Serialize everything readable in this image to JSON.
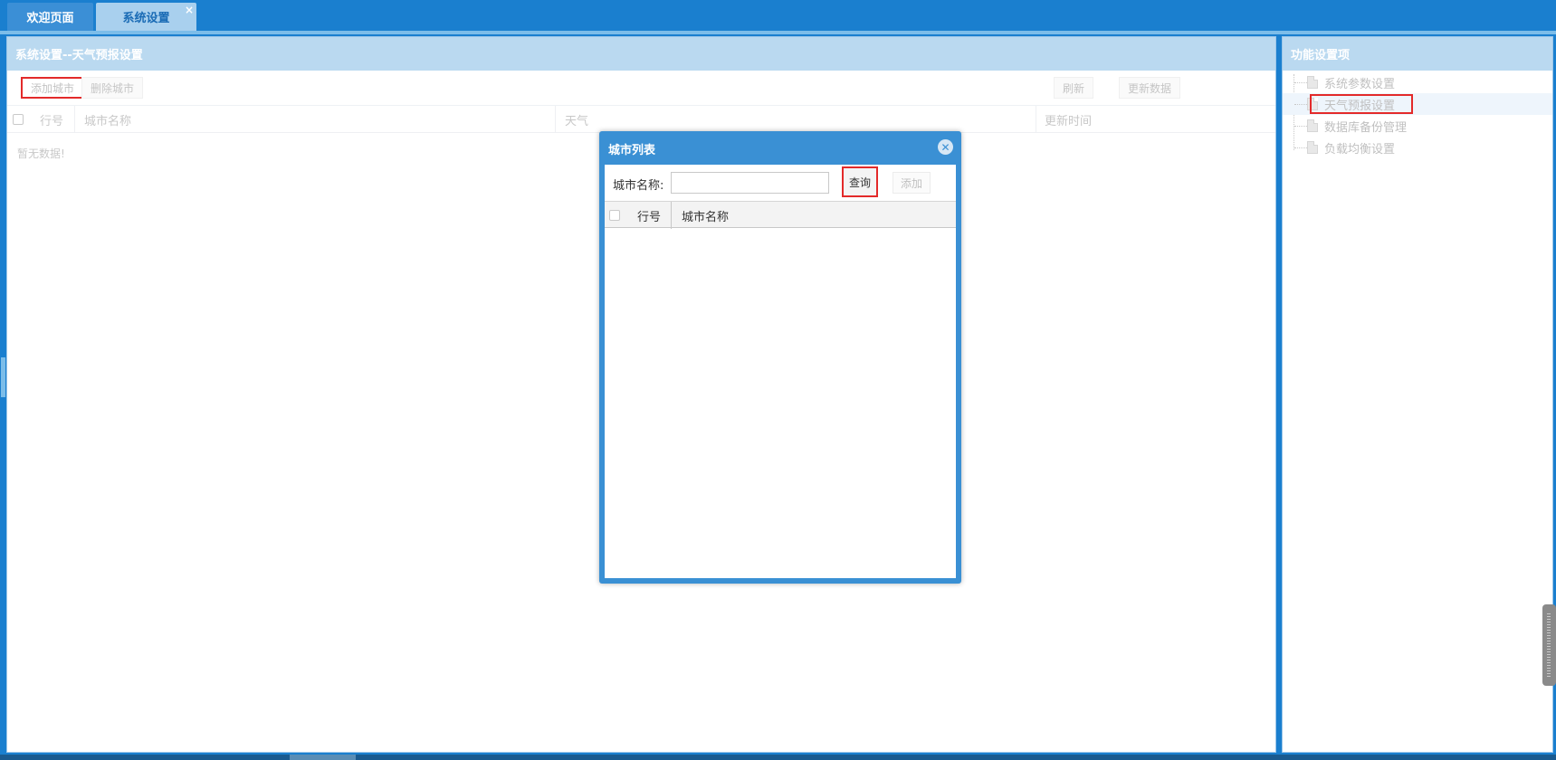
{
  "tabs": {
    "welcome": "欢迎页面",
    "settings": "系统设置",
    "close_glyph": "×"
  },
  "main_panel": {
    "title": "系统设置--天气预报设置",
    "toolbar": {
      "add_city": "添加城市",
      "delete_city": "删除城市",
      "refresh": "刷新",
      "update_data": "更新数据"
    },
    "grid": {
      "columns": [
        "行号",
        "城市名称",
        "天气",
        "更新时间"
      ],
      "rows": [],
      "empty_text": "暂无数据!"
    }
  },
  "side_panel": {
    "title": "功能设置项",
    "items": [
      {
        "label": "系统参数设置",
        "selected": false
      },
      {
        "label": "天气预报设置",
        "selected": true
      },
      {
        "label": "数据库备份管理",
        "selected": false
      },
      {
        "label": "负载均衡设置",
        "selected": false
      }
    ],
    "icon": "document-icon"
  },
  "dialog": {
    "title": "城市列表",
    "close_icon": "close-circle-icon",
    "search_label": "城市名称:",
    "search_value": "",
    "query_button": "查询",
    "add_button": "添加",
    "grid": {
      "columns": [
        "行号",
        "城市名称"
      ],
      "rows": []
    }
  },
  "colors": {
    "accent": "#1a7fcf",
    "highlight": "#e32a2a",
    "panel_header": "#bad9f0"
  }
}
